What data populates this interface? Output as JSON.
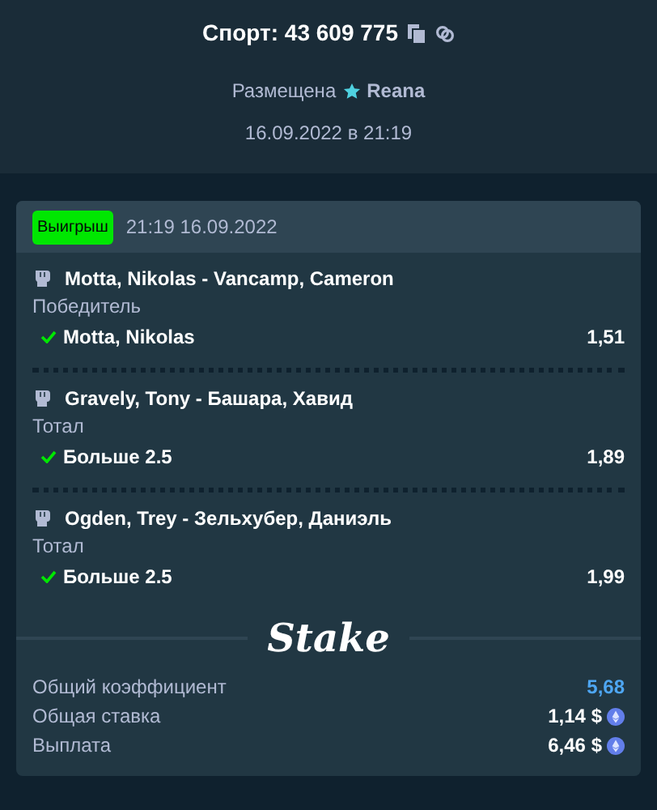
{
  "header": {
    "title": "Спорт: 43 609 775",
    "placed_label": "Размещена",
    "user": "Reana",
    "date": "16.09.2022 в 21:19"
  },
  "bet": {
    "status": {
      "label": "Выигрыш",
      "kind": "won"
    },
    "time": "21:19 16.09.2022",
    "legs": [
      {
        "event": "Motta, Nikolas - Vancamp, Cameron",
        "market": "Победитель",
        "outcome": "Motta, Nikolas",
        "odds": "1,51",
        "won": true
      },
      {
        "event": "Gravely, Tony - Башара, Хавид",
        "market": "Тотал",
        "outcome": "Больше 2.5",
        "odds": "1,89",
        "won": true
      },
      {
        "event": "Ogden, Trey - Зельхубер, Даниэль",
        "market": "Тотал",
        "outcome": "Больше 2.5",
        "odds": "1,99",
        "won": true
      }
    ],
    "logo": "Stake",
    "summary": [
      {
        "label": "Общий коэффициент",
        "value": "5,68",
        "kind": "odds"
      },
      {
        "label": "Общая ставка",
        "value": "1,14 $",
        "kind": "money"
      },
      {
        "label": "Выплата",
        "value": "6,46 $",
        "kind": "money"
      }
    ]
  }
}
